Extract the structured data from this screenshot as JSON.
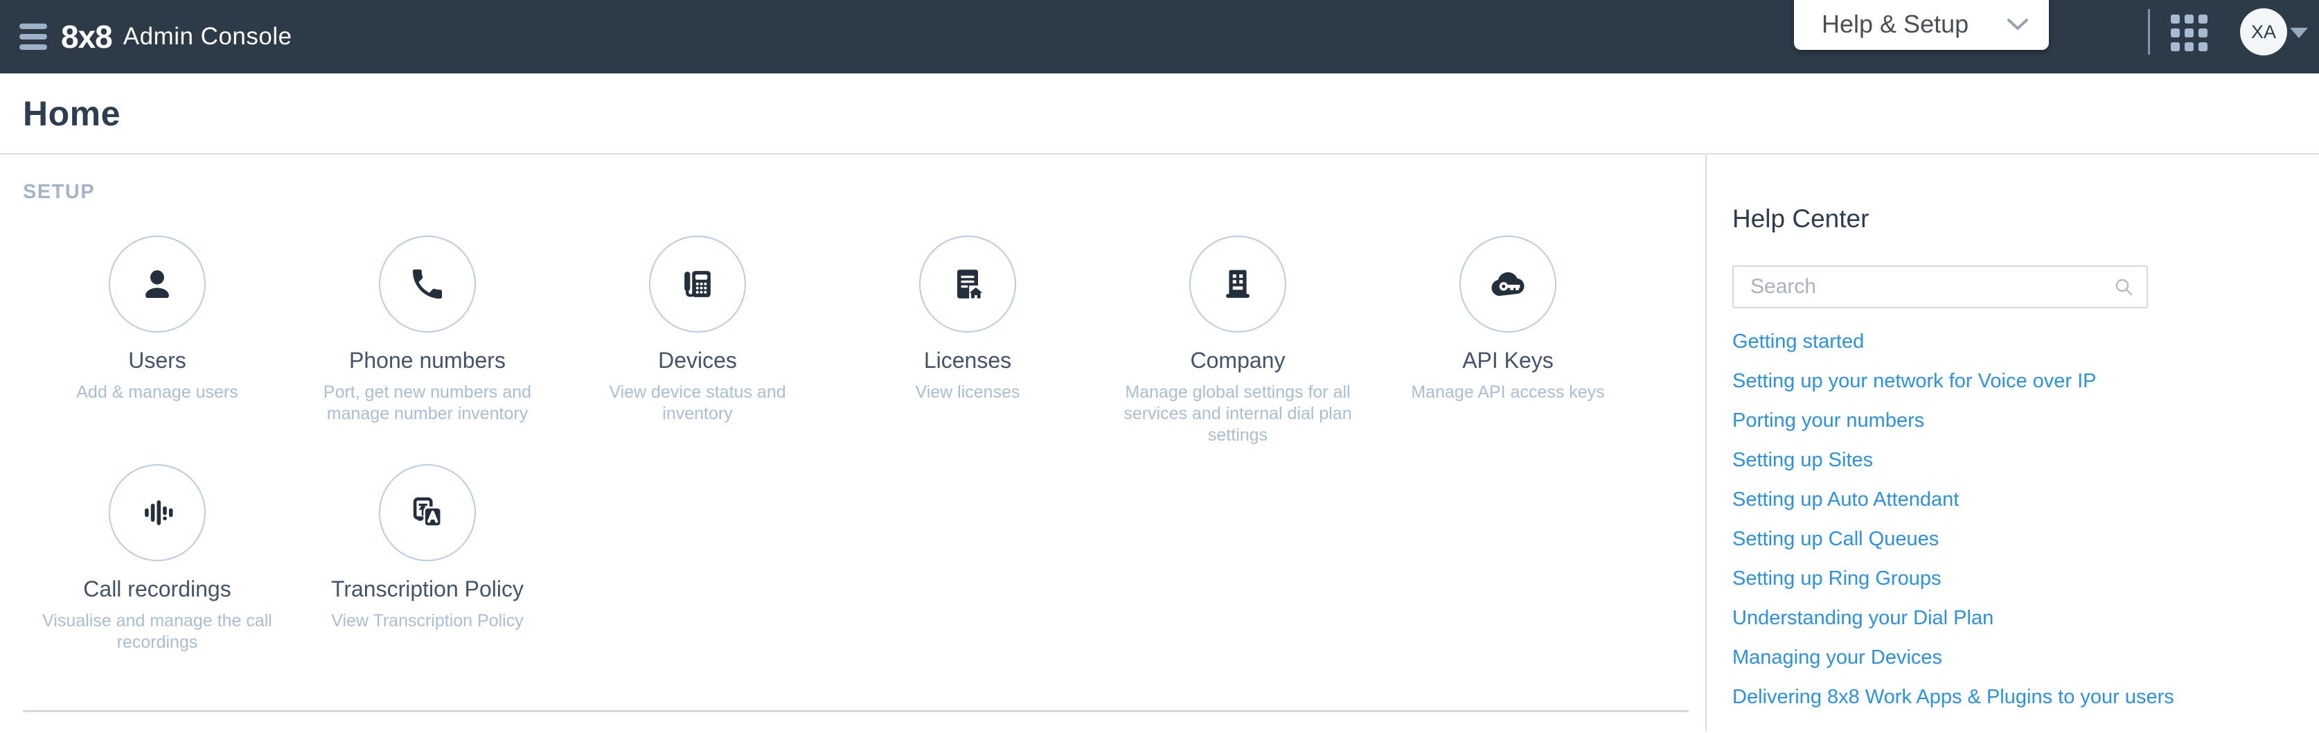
{
  "topbar": {
    "brand": "8x8",
    "app_title": "Admin Console",
    "help_setup_label": "Help & Setup",
    "avatar_initials": "XA"
  },
  "page": {
    "title": "Home"
  },
  "setup": {
    "section_label": "SETUP",
    "tiles": [
      {
        "label": "Users",
        "description": "Add & manage users",
        "icon": "user-icon"
      },
      {
        "label": "Phone numbers",
        "description": "Port, get new numbers and manage number inventory",
        "icon": "phone-icon"
      },
      {
        "label": "Devices",
        "description": "View device status and inventory",
        "icon": "desk-phone-icon"
      },
      {
        "label": "Licenses",
        "description": "View licenses",
        "icon": "license-icon"
      },
      {
        "label": "Company",
        "description": "Manage global settings for all services and internal dial plan settings",
        "icon": "building-icon"
      },
      {
        "label": "API Keys",
        "description": "Manage API access keys",
        "icon": "cloud-key-icon"
      },
      {
        "label": "Call recordings",
        "description": "Visualise and manage the call recordings",
        "icon": "waveform-icon"
      },
      {
        "label": "Transcription Policy",
        "description": "View Transcription Policy",
        "icon": "translate-icon"
      }
    ]
  },
  "help_center": {
    "title": "Help Center",
    "search_placeholder": "Search",
    "links": [
      "Getting started",
      "Setting up your network for Voice over IP",
      "Porting your numbers",
      "Setting up Sites",
      "Setting up Auto Attendant",
      "Setting up Call Queues",
      "Setting up Ring Groups",
      "Understanding your Dial Plan",
      "Managing your Devices",
      "Delivering 8x8 Work Apps & Plugins to your users"
    ]
  },
  "colors": {
    "topbar_bg": "#2d3b49",
    "accent_blue_link": "#2a91e8",
    "muted_steel": "#a5b5c9",
    "icon_dark": "#242f3d",
    "circle_border": "#bbcce0",
    "divider": "#d8dde6"
  }
}
